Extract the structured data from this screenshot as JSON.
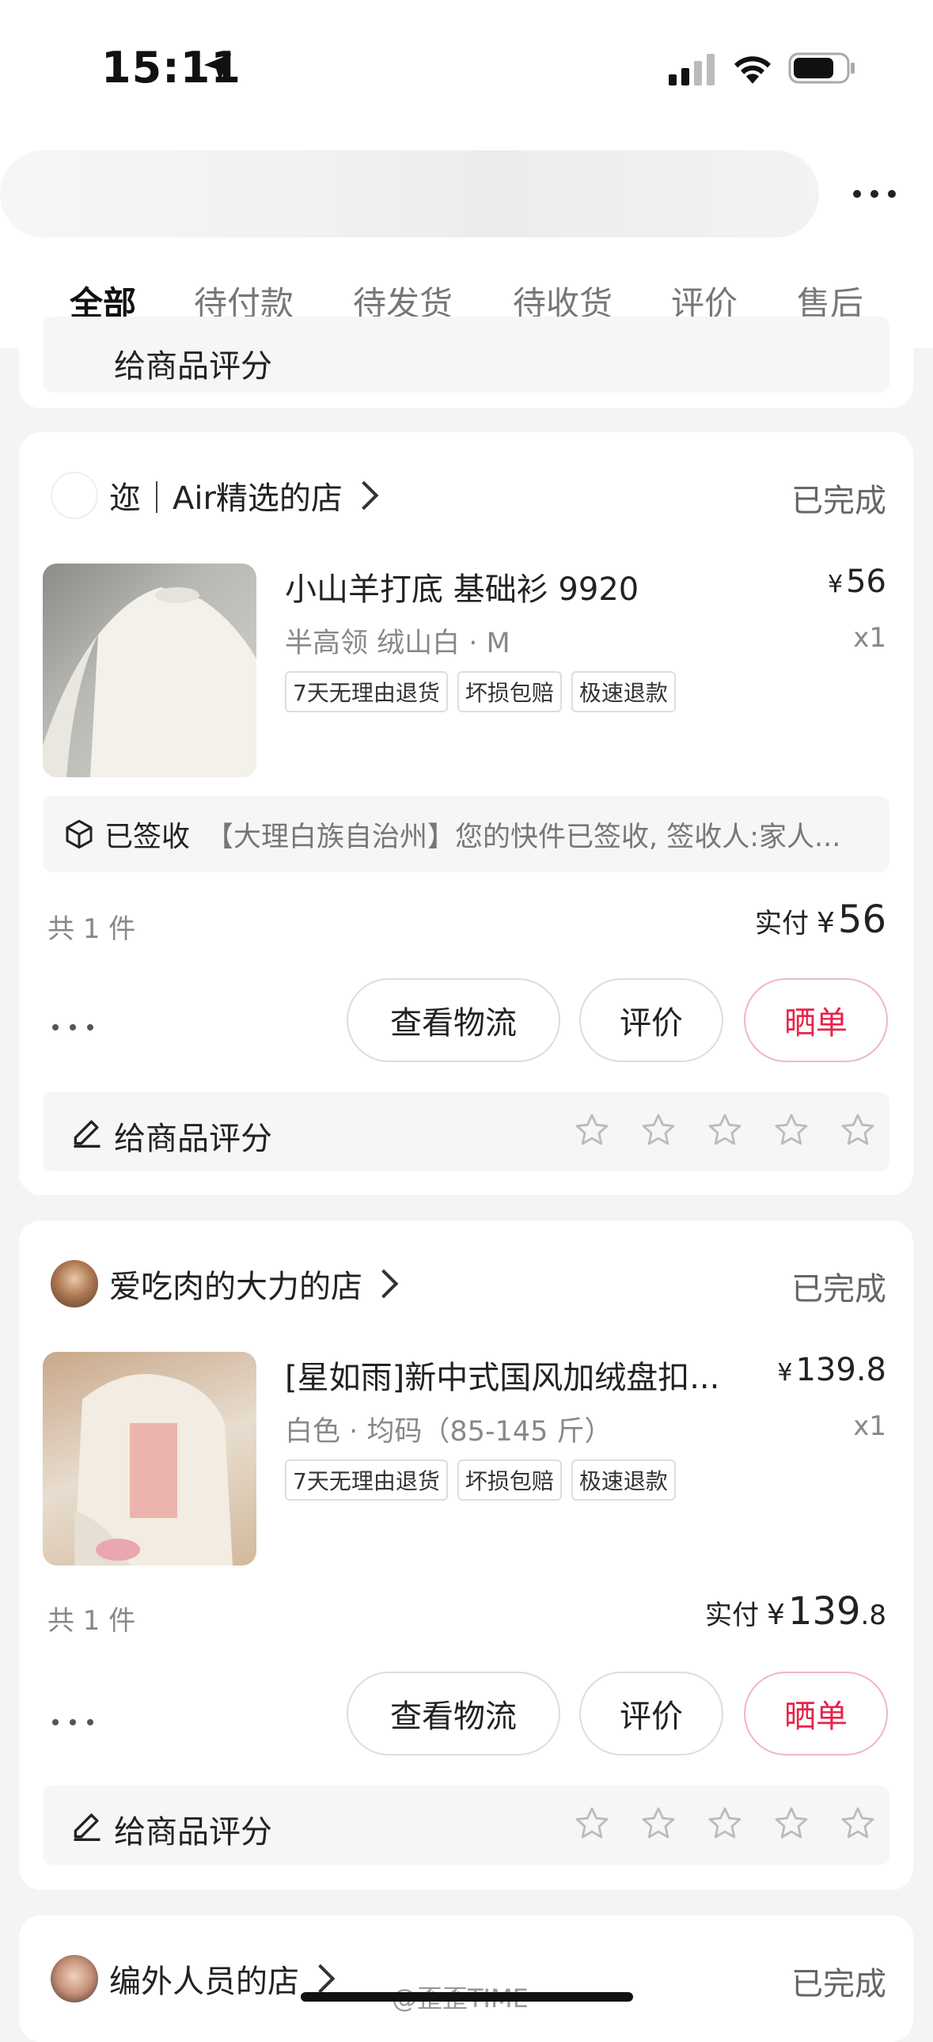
{
  "status_bar": {
    "time": "15:11"
  },
  "tabs": [
    "全部",
    "待付款",
    "待发货",
    "待收货",
    "评价",
    "售后"
  ],
  "partial_card": {
    "rate_label": "给商品评分"
  },
  "orders": [
    {
      "shop_name": "迩｜Air精选的店",
      "status": "已完成",
      "product_title": "小山羊打底 基础衫 9920",
      "price_currency": "¥",
      "price": "56",
      "spec": "半高领 绒山白 · M",
      "qty": "x1",
      "tags": [
        "7天无理由退货",
        "坏损包赔",
        "极速退款"
      ],
      "logistics_status": "已签收",
      "logistics_text": "【大理白族自治州】您的快件已签收, 签收人:家人...",
      "count": "共 1 件",
      "paid_label": "实付",
      "paid_currency": "¥",
      "paid_int": "56",
      "paid_dec": "",
      "buttons": {
        "logistics": "查看物流",
        "review": "评价",
        "share": "晒单"
      },
      "rate_label": "给商品评分"
    },
    {
      "shop_name": "爱吃肉的大力的店",
      "status": "已完成",
      "product_title": "[星如雨]新中式国风加绒盘扣...",
      "price_currency": "¥",
      "price": "139.8",
      "spec": "白色 · 均码（85-145 斤）",
      "qty": "x1",
      "tags": [
        "7天无理由退货",
        "坏损包赔",
        "极速退款"
      ],
      "count": "共 1 件",
      "paid_label": "实付",
      "paid_currency": "¥",
      "paid_int": "139",
      "paid_dec": ".8",
      "buttons": {
        "logistics": "查看物流",
        "review": "评价",
        "share": "晒单"
      },
      "rate_label": "给商品评分"
    },
    {
      "shop_name": "编外人员的店",
      "status": "已完成"
    }
  ],
  "watermark": "@歪歪TIME",
  "colors": {
    "accent": "#e8234a",
    "bg": "#f4f4f4"
  }
}
